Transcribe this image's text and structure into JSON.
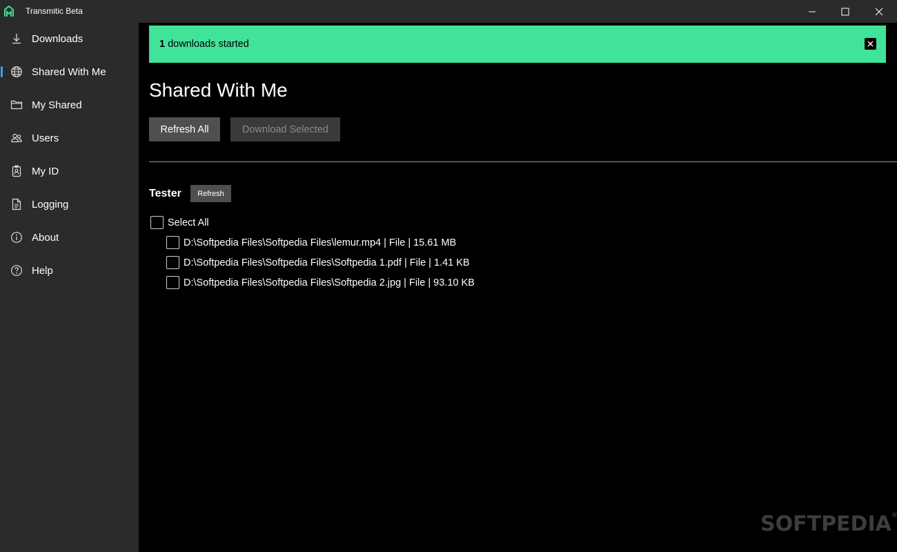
{
  "window": {
    "title": "Transmitic Beta",
    "logo_icon": "transmitic-logo-icon",
    "accent_color": "#41e39a"
  },
  "sidebar": {
    "active_indicator_color": "#3aa0f0",
    "items": [
      {
        "label": "Downloads",
        "icon": "download-icon"
      },
      {
        "label": "Shared With Me",
        "icon": "globe-icon",
        "active": true
      },
      {
        "label": "My Shared",
        "icon": "folder-icon"
      },
      {
        "label": "Users",
        "icon": "users-icon"
      },
      {
        "label": "My ID",
        "icon": "id-badge-icon"
      },
      {
        "label": "Logging",
        "icon": "document-icon"
      },
      {
        "label": "About",
        "icon": "info-icon"
      },
      {
        "label": "Help",
        "icon": "help-icon"
      }
    ]
  },
  "toast": {
    "count": "1",
    "message": "downloads started",
    "background": "#41e39a"
  },
  "main": {
    "title": "Shared With Me",
    "refresh_all_label": "Refresh All",
    "download_selected_label": "Download Selected",
    "user": {
      "name": "Tester",
      "refresh_label": "Refresh",
      "select_all_label": "Select All",
      "files": [
        "D:\\Softpedia Files\\Softpedia Files\\lemur.mp4 | File | 15.61 MB",
        "D:\\Softpedia Files\\Softpedia Files\\Softpedia 1.pdf | File | 1.41 KB",
        "D:\\Softpedia Files\\Softpedia Files\\Softpedia 2.jpg | File | 93.10 KB"
      ]
    }
  },
  "watermark": {
    "text": "SOFTPEDIA",
    "mark": "®"
  }
}
